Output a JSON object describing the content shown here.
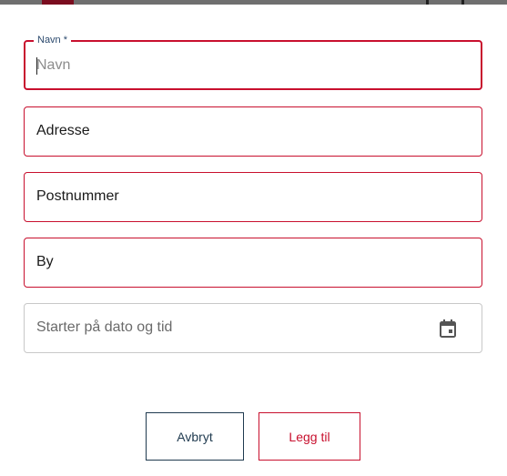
{
  "form": {
    "name_field": {
      "label": "Navn",
      "required_mark": "*",
      "placeholder": "Navn",
      "value": ""
    },
    "address_field": {
      "value": "Adresse"
    },
    "postcode_field": {
      "value": "Postnummer"
    },
    "city_field": {
      "value": "By"
    },
    "start_field": {
      "placeholder": "Starter på dato og tid",
      "icon": "calendar-icon"
    }
  },
  "actions": {
    "cancel_label": "Avbryt",
    "add_label": "Legg til"
  },
  "colors": {
    "accent": "#c8102e",
    "secondary": "#1f3a4f",
    "label": "#2c4a6e"
  }
}
